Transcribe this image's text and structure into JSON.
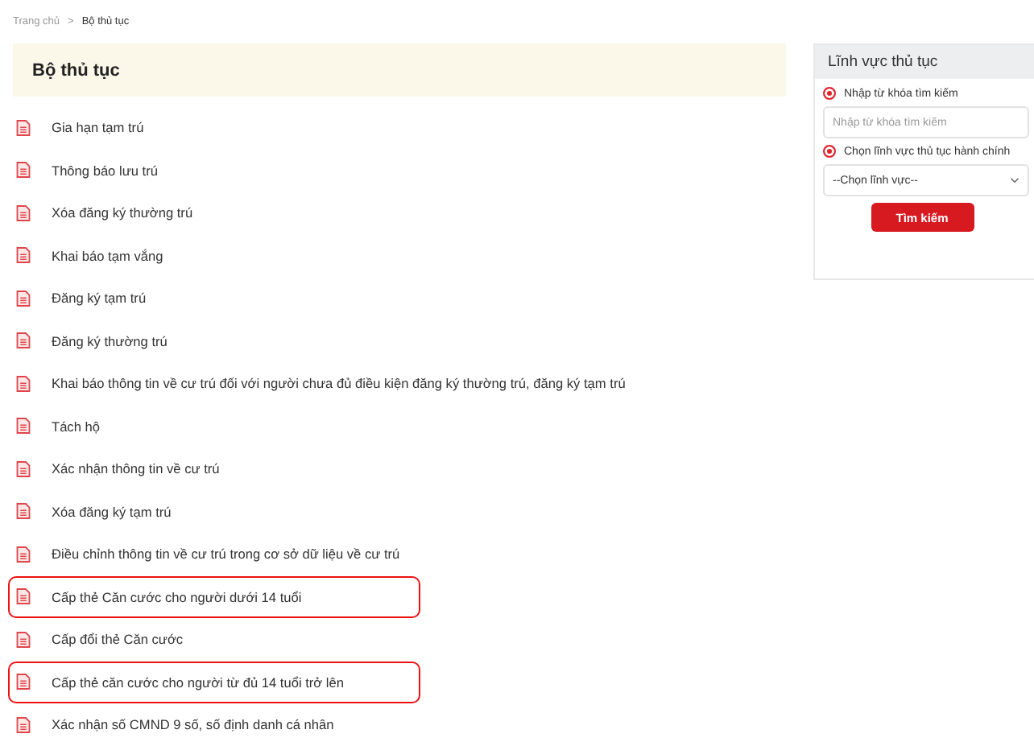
{
  "breadcrumb": [
    {
      "label": "Trang chủ",
      "current": false
    },
    {
      "label": "Bộ thủ tục",
      "current": true
    }
  ],
  "breadcrumb_separator": ">",
  "main": {
    "title": "Bộ thủ tục",
    "items": [
      {
        "label": "Gia hạn tạm trú",
        "highlighted": false
      },
      {
        "label": "Thông báo lưu trú",
        "highlighted": false
      },
      {
        "label": "Xóa đăng ký thường trú",
        "highlighted": false
      },
      {
        "label": "Khai báo tạm vắng",
        "highlighted": false
      },
      {
        "label": "Đăng ký tạm trú",
        "highlighted": false
      },
      {
        "label": "Đăng ký thường trú",
        "highlighted": false
      },
      {
        "label": "Khai báo thông tin về cư trú đối với người chưa đủ điều kiện đăng ký thường trú, đăng ký tạm trú",
        "highlighted": false
      },
      {
        "label": "Tách hộ",
        "highlighted": false
      },
      {
        "label": "Xác nhận thông tin về cư trú",
        "highlighted": false
      },
      {
        "label": "Xóa đăng ký tạm trú",
        "highlighted": false
      },
      {
        "label": "Điều chỉnh thông tin về cư trú trong cơ sở dữ liệu về cư trú",
        "highlighted": false
      },
      {
        "label": "Cấp thẻ Căn cước cho người dưới 14 tuổi",
        "highlighted": true
      },
      {
        "label": "Cấp đổi thẻ Căn cước",
        "highlighted": false
      },
      {
        "label": "Cấp thẻ căn cước cho người từ đủ 14 tuổi trở lên",
        "highlighted": true
      },
      {
        "label": "Xác nhận số CMND 9 số, số định danh cá nhân",
        "highlighted": false
      }
    ]
  },
  "sidebar": {
    "title": "Lĩnh vực thủ tục",
    "keyword_option": {
      "label": "Nhập từ khóa tìm kiếm",
      "selected": true
    },
    "keyword_field": {
      "placeholder": "Nhập từ khóa tìm kiếm"
    },
    "field_option": {
      "label": "Chọn lĩnh vực thủ tục hành chính",
      "selected": true
    },
    "field_select": {
      "value": "--Chọn lĩnh vực--"
    },
    "search_button": "Tìm kiếm"
  }
}
